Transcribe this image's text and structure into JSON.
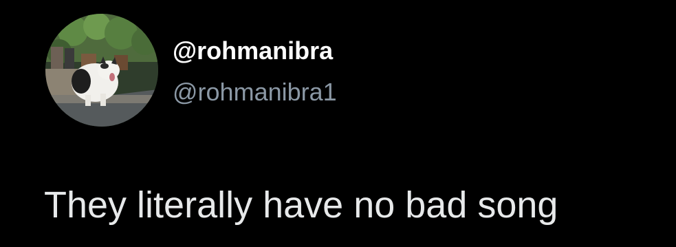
{
  "tweet": {
    "author": {
      "display_name": "@rohmanibra",
      "handle": "@rohmanibra1",
      "avatar_icon": "cat-avatar-photo"
    },
    "text": "They literally have no bad song"
  },
  "colors": {
    "background": "#000000",
    "display_name": "#ffffff",
    "handle": "#8b98a5",
    "tweet_text": "#e7e9ea"
  }
}
